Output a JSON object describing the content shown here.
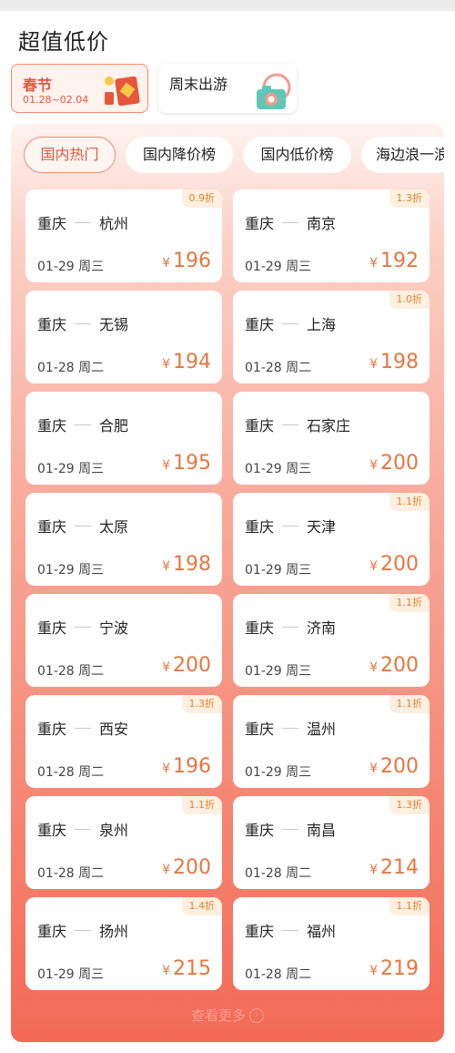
{
  "section_title": "超值低价",
  "festival": {
    "name": "春节",
    "dates": "01.28~02.04"
  },
  "weekend": {
    "name": "周末出游"
  },
  "tabs": [
    "国内热门",
    "国内降价榜",
    "国内低价榜",
    "海边浪一浪"
  ],
  "currency_symbol": "¥",
  "colors": {
    "accent": "#e6553d",
    "price": "#e6763f",
    "badge_text": "#e8812d",
    "badge_bg": "#fdf0e0"
  },
  "routes": [
    {
      "from": "重庆",
      "to": "杭州",
      "date": "01-29 周三",
      "price": "196",
      "discount": "0.9折"
    },
    {
      "from": "重庆",
      "to": "南京",
      "date": "01-29 周三",
      "price": "192",
      "discount": "1.3折"
    },
    {
      "from": "重庆",
      "to": "无锡",
      "date": "01-28 周二",
      "price": "194",
      "discount": ""
    },
    {
      "from": "重庆",
      "to": "上海",
      "date": "01-28 周二",
      "price": "198",
      "discount": "1.0折"
    },
    {
      "from": "重庆",
      "to": "合肥",
      "date": "01-29 周三",
      "price": "195",
      "discount": ""
    },
    {
      "from": "重庆",
      "to": "石家庄",
      "date": "01-29 周三",
      "price": "200",
      "discount": ""
    },
    {
      "from": "重庆",
      "to": "太原",
      "date": "01-29 周三",
      "price": "198",
      "discount": ""
    },
    {
      "from": "重庆",
      "to": "天津",
      "date": "01-29 周三",
      "price": "200",
      "discount": "1.1折"
    },
    {
      "from": "重庆",
      "to": "宁波",
      "date": "01-28 周二",
      "price": "200",
      "discount": ""
    },
    {
      "from": "重庆",
      "to": "济南",
      "date": "01-29 周三",
      "price": "200",
      "discount": "1.1折"
    },
    {
      "from": "重庆",
      "to": "西安",
      "date": "01-28 周二",
      "price": "196",
      "discount": "1.3折"
    },
    {
      "from": "重庆",
      "to": "温州",
      "date": "01-29 周三",
      "price": "200",
      "discount": "1.1折"
    },
    {
      "from": "重庆",
      "to": "泉州",
      "date": "01-28 周二",
      "price": "200",
      "discount": "1.1折"
    },
    {
      "from": "重庆",
      "to": "南昌",
      "date": "01-28 周二",
      "price": "214",
      "discount": "1.3折"
    },
    {
      "from": "重庆",
      "to": "扬州",
      "date": "01-29 周三",
      "price": "215",
      "discount": "1.4折"
    },
    {
      "from": "重庆",
      "to": "福州",
      "date": "01-28 周二",
      "price": "219",
      "discount": "1.1折"
    }
  ],
  "more_label": "查看更多"
}
